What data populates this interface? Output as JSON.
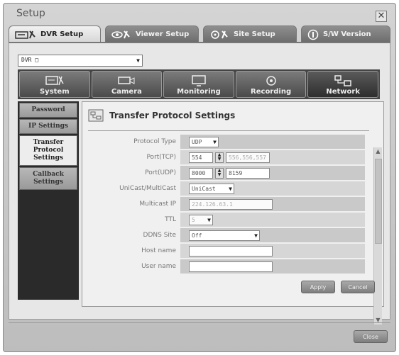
{
  "window": {
    "title": "Setup",
    "close_glyph": "✕"
  },
  "tabs": [
    {
      "label": "DVR Setup",
      "icon": "dvr-setup-icon",
      "active": true
    },
    {
      "label": "Viewer Setup",
      "icon": "viewer-setup-icon",
      "active": false
    },
    {
      "label": "Site Setup",
      "icon": "site-setup-icon",
      "active": false
    },
    {
      "label": "S/W Version",
      "icon": "info-icon",
      "active": false
    }
  ],
  "dvr_select": {
    "value": "DVR □",
    "arrow": "▼"
  },
  "categories": [
    {
      "label": "System",
      "icon": "system-icon"
    },
    {
      "label": "Camera",
      "icon": "camera-icon"
    },
    {
      "label": "Monitoring",
      "icon": "monitoring-icon"
    },
    {
      "label": "Recording",
      "icon": "recording-icon"
    },
    {
      "label": "Network",
      "icon": "network-icon",
      "active": true
    }
  ],
  "sidebar": [
    {
      "label": "Password",
      "active": false
    },
    {
      "label": "IP Settings",
      "active": false
    },
    {
      "label": "Transfer\nProtocol\nSettings",
      "active": true
    },
    {
      "label": "Callback\nSettings",
      "active": false
    }
  ],
  "content": {
    "title": "Transfer Protocol Settings",
    "icon": "transfer-protocol-icon",
    "fields": {
      "protocol_type": {
        "label": "Protocol Type",
        "value": "UDP"
      },
      "port_tcp": {
        "label": "Port(TCP)",
        "value": "554",
        "range": "556,556,557"
      },
      "port_udp": {
        "label": "Port(UDP)",
        "value": "8000",
        "range": "8159"
      },
      "unicast_multicast": {
        "label": "UniCast/MultiCast",
        "value": "UniCast"
      },
      "multicast_ip": {
        "label": "Multicast IP",
        "value": "224.126.63.1"
      },
      "ttl": {
        "label": "TTL",
        "value": "5"
      },
      "ddns_site": {
        "label": "DDNS Site",
        "value": "Off"
      },
      "host_name": {
        "label": "Host name",
        "value": ""
      },
      "user_name": {
        "label": "User name",
        "value": ""
      }
    },
    "buttons": {
      "apply": "Apply",
      "cancel": "Cancel"
    }
  },
  "footer": {
    "close_button": "Close"
  }
}
